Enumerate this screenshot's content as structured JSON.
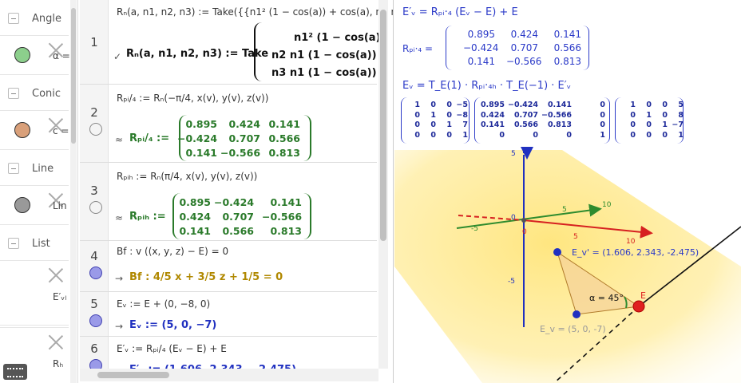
{
  "sidebar": {
    "categories": [
      "Angle",
      "Conic",
      "Line",
      "List"
    ],
    "items": [
      {
        "label": "α =",
        "color": "#8ccf8c"
      },
      {
        "label": "c =",
        "color": "#d9a07a"
      },
      {
        "label": "Lin",
        "color": "#999999"
      },
      {
        "label": "E′ᵥₗ"
      },
      {
        "label": "Rₕ"
      }
    ]
  },
  "algebra": {
    "row1": {
      "number": "1",
      "definition": "Rₙ(a, n1, n2, n3) := Take({{n1² (1 − cos(a)) + cos(a), n1 n2 (1 −",
      "check": "✓",
      "value_lhs": "Rₙ(a, n1, n2, n3) := Take",
      "matrix_rows": [
        "n1² (1 − cos(a))",
        "n2 n1 (1 − cos(a)) + n",
        "n3 n1 (1 − cos(a)) − n"
      ]
    },
    "row2": {
      "number": "2",
      "definition": "Rₚᵢ/₄ := Rₙ(−π/4, x(v), y(v), z(v))",
      "approx": "≈",
      "lhs": "Rₚᵢ/₄ :=",
      "matrix": [
        [
          "0.895",
          "0.424",
          "0.141"
        ],
        [
          "−0.424",
          "0.707",
          "0.566"
        ],
        [
          "0.141",
          "−0.566",
          "0.813"
        ]
      ]
    },
    "row3": {
      "number": "3",
      "definition": "Rₚᵢₕ := Rₙ(π/4, x(v), y(v), z(v))",
      "approx": "≈",
      "lhs": "Rₚᵢₕ :=",
      "matrix": [
        [
          "0.895",
          "−0.424",
          "0.141"
        ],
        [
          "0.424",
          "0.707",
          "−0.566"
        ],
        [
          "0.141",
          "0.566",
          "0.813"
        ]
      ]
    },
    "row4": {
      "number": "4",
      "definition": "Bf : v ((x, y, z) − E) = 0",
      "arrow": "→",
      "value": "Bf :  4/5 x + 3/5 z + 1/5 = 0"
    },
    "row5": {
      "number": "5",
      "definition": "Eᵥ := E + (0, −8, 0)",
      "arrow": "→",
      "value": "Eᵥ := (5, 0, −7)"
    },
    "row6": {
      "number": "6",
      "definition": "E′ᵥ := Rₚᵢ/₄ (Eᵥ − E) + E",
      "value": "E′ᵥ := (1.606, 2.343, −2.475)"
    }
  },
  "graphics": {
    "eq1": "E′ᵥ = Rₚᵢ·₄ (Eᵥ − E) + E",
    "r_label": "Rₚᵢ·₄ =",
    "r_matrix": [
      [
        "0.895",
        "0.424",
        "0.141"
      ],
      [
        "−0.424",
        "0.707",
        "0.566"
      ],
      [
        "0.141",
        "−0.566",
        "0.813"
      ]
    ],
    "eq2": "Eᵥ = T_E(1) · Rₚᵢ·₄ₕ · T_E(−1) · E′ᵥ",
    "m1": [
      [
        "1",
        "0",
        "0",
        "−5"
      ],
      [
        "0",
        "1",
        "0",
        "−8"
      ],
      [
        "0",
        "0",
        "1",
        "7"
      ],
      [
        "0",
        "0",
        "0",
        "1"
      ]
    ],
    "m2": [
      [
        "0.895",
        "−0.424",
        "0.141",
        "0"
      ],
      [
        "0.424",
        "0.707",
        "−0.566",
        "0"
      ],
      [
        "0.141",
        "0.566",
        "0.813",
        "0"
      ],
      [
        "0",
        "0",
        "0",
        "1"
      ]
    ],
    "m3": [
      [
        "1",
        "0",
        "0",
        "5"
      ],
      [
        "0",
        "1",
        "0",
        "8"
      ],
      [
        "0",
        "0",
        "1",
        "−7"
      ],
      [
        "0",
        "0",
        "0",
        "1"
      ]
    ],
    "axis_labels": {
      "z5": "5",
      "z0": "0",
      "zm5": "-5",
      "y5": "5",
      "y10": "10",
      "x5": "5",
      "x10": "10",
      "o": "0",
      "neg": "-5"
    },
    "point_ev_prime": "E_v' = (1.606, 2.343, -2.475)",
    "alpha": "α = 45°",
    "point_e": "E",
    "point_ev": "E_v = (5, 0, -7)",
    "colors": {
      "accent": "#2b3ac8",
      "plane": "#ffe680",
      "x_axis": "#d62020",
      "y_axis": "#2e8b2e",
      "z_axis": "#2030c0",
      "triangle": "#f5d39a"
    }
  }
}
